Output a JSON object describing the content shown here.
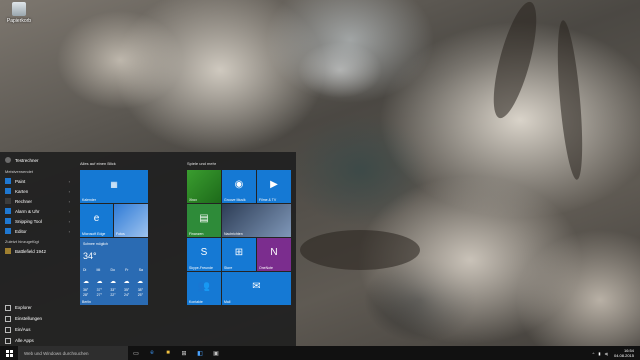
{
  "desktop": {
    "icon_label": "Papierkorb"
  },
  "start_menu": {
    "user_name": "Testrechner",
    "most_used_label": "Meistverwendet",
    "most_used": [
      {
        "label": "Paint",
        "icon": "paint-icon",
        "color": "#1f78d1"
      },
      {
        "label": "Karten",
        "icon": "maps-icon",
        "color": "#1f78d1"
      },
      {
        "label": "Rechner",
        "icon": "calculator-icon",
        "color": "#3c3c3c"
      },
      {
        "label": "Alarm & Uhr",
        "icon": "alarm-icon",
        "color": "#1f78d1"
      },
      {
        "label": "Snipping Tool",
        "icon": "snip-icon",
        "color": "#1f78d1"
      },
      {
        "label": "Editor",
        "icon": "notepad-icon",
        "color": "#1f78d1"
      }
    ],
    "recently_added_label": "Zuletzt hinzugefügt",
    "recently_added": [
      {
        "label": "Battlefield 1942",
        "icon": "game-icon",
        "color": "#a08030"
      }
    ],
    "bottom_items": [
      {
        "label": "Explorer",
        "icon": "folder-icon"
      },
      {
        "label": "Einstellungen",
        "icon": "gear-icon"
      },
      {
        "label": "Ein/Aus",
        "icon": "power-icon"
      },
      {
        "label": "Alle Apps",
        "icon": "list-icon"
      }
    ],
    "group_left_title": "Alles auf einen Blick",
    "group_right_title": "Spiele und mehr",
    "tiles": {
      "calendar": "Kalender",
      "edge": "Microsoft Edge",
      "photos": "Fotos",
      "weather_city": "Schnee möglich",
      "weather_temp": "34°",
      "weather_days": [
        "Di",
        "Mi",
        "Do",
        "Fr",
        "Sa"
      ],
      "weather_highs": [
        "36°",
        "37°",
        "33°",
        "35°",
        "38°"
      ],
      "weather_lows": [
        "28°",
        "27°",
        "22°",
        "24°",
        "25°"
      ],
      "weather_location": "Berlin",
      "xbox": "Xbox",
      "groove": "Groove Musik",
      "movies": "Filme & TV",
      "finance": "Finanzen",
      "news": "Nachrichten",
      "skype": "Skype-Freunde",
      "store": "Store",
      "onenote": "OneNote",
      "contacts": "Kontakte",
      "mail": "Mail"
    }
  },
  "taskbar": {
    "search_placeholder": "Web und Windows durchsuchen",
    "pinned": [
      "task-view-icon",
      "edge-icon",
      "explorer-icon",
      "store-icon",
      "app-icon",
      "app-icon"
    ],
    "time": "16:54",
    "date": "04.08.2015"
  }
}
